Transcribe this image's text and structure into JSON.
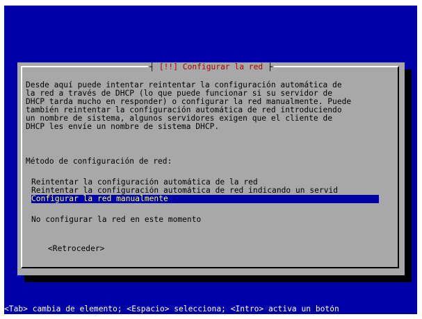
{
  "dialog": {
    "title_left": "┤",
    "title": "[!!] Configurar la red",
    "title_right": "├",
    "body": "Desde aquí puede intentar reintentar la configuración automática de\nla red a través de DHCP (lo que puede funcionar si su servidor de\nDHCP tarda mucho en responder) o configurar la red manualmente. Puede\ntambién reintentar la configuración automática de red introduciendo\nun nombre de sistema, algunos servidores exigen que el cliente de\nDHCP les envíe un nombre de sistema DHCP.",
    "prompt": "Método de configuración de red:",
    "options": [
      "Reintentar la configuración automática de la red",
      "Reintentar la configuración automática de red indicando un servid",
      "Configurar la red manualmente",
      "No configurar la red en este momento"
    ],
    "selected_index": 2,
    "back_button": "<Retroceder>"
  },
  "status_bar": "<Tab> cambia de elemento; <Espacio> selecciona; <Intro> activa un botón",
  "colors": {
    "screen_bg": "#0000a8",
    "dialog_bg": "#a8a8a8",
    "title_fg": "#a80000",
    "selected_bg": "#0000a8",
    "selected_fg": "#ffff54"
  }
}
